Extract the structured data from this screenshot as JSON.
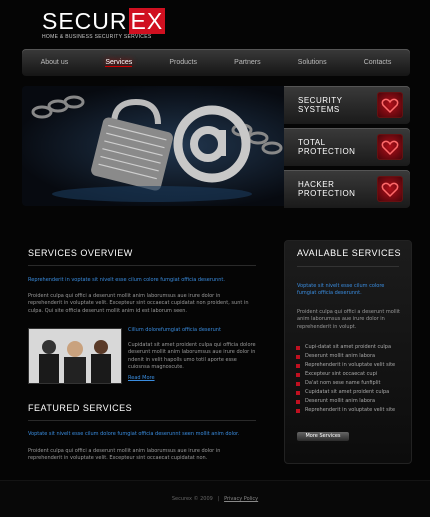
{
  "logo": {
    "main": "SECUR",
    "highlight": "EX",
    "tagline": "HOME & BUSINESS SECURITY SERVICES"
  },
  "nav": {
    "items": [
      "About us",
      "Services",
      "Products",
      "Partners",
      "Solutions",
      "Contacts"
    ],
    "active": "Services"
  },
  "promos": [
    {
      "line1": "SECURITY",
      "line2": "SYSTEMS"
    },
    {
      "line1": "TOTAL",
      "line2": "PROTECTION"
    },
    {
      "line1": "HACKER",
      "line2": "PROTECTION"
    }
  ],
  "services_overview": {
    "title": "SERVICES OVERVIEW",
    "lead": "Reprehenderit in voptate sit nivelt esse cilum colore fumgiat officia deserunnt.",
    "body": "Proident culpa qui offici a deserunt mollit anim laborumsus aue irure dolor in reprehenderit in voluptate velit. Excepteur sint occaecat cupidatat non proident, sunt in culpa. Qui site officia deserunt mollit anim id est laborum seen.",
    "item_title": "Cillum dolorefumgiat officia deserunt",
    "item_body": "Cupidatat sit amet proident culpa qui officia dolore deserunt mollit anim laborumsus aue irure dolor in ndenit in velit hapolls umo totil aporte esse cuiosnsa magnoscute.",
    "read_more": "Read More"
  },
  "featured": {
    "title": "FEATURED SERVICES",
    "lead": "Voptate sit nivelt esse cilum dolore fumgiat officia deserunnt seen mollit anim dolor.",
    "body": "Proident culpa qui offici a deserunt mollit anim laborumsus aue irure dolor in reprehenderit in voluptate velit. Excepteur sint occaecat cupidatat non."
  },
  "available": {
    "title": "AVAILABLE SERVICES",
    "lead": "Voptate sit nivelt esse cilum colore fumgiat officia deserunnt.",
    "body": "Proident culpa qui offici a deserunt mollit anim laborumsus aue irure dolor in reprehenderit in volupt.",
    "items": [
      "Cupi-datat sit amet proident culpa",
      "Deserunt mollit anim labora",
      "Reprehenderit in voluptate velit site",
      "Excepteur sint occaecat cupi",
      "Da'at nom sese name funfiplit",
      "Cupidatat sit amet proident culpa",
      "Deserunt mollit anim labora",
      "Reprehenderit in voluptate velit site"
    ],
    "button": "More Services"
  },
  "footer": {
    "copyright": "Securex © 2009",
    "sep": "|",
    "privacy": "Privacy Policy"
  },
  "colors": {
    "accent": "#d01020",
    "link": "#3a8de0"
  }
}
